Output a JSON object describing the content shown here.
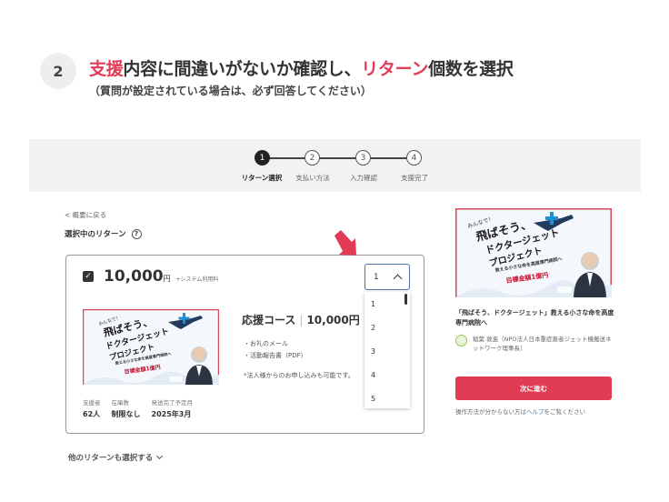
{
  "instruction": {
    "step_number": "2",
    "accent_1": "支援",
    "part_1": "内容に間違いがないか確認し、",
    "accent_2": "リターン",
    "part_2": "個数を選択",
    "subtitle": "（質問が設定されている場合は、必ず回答してください）"
  },
  "stepper": {
    "steps": [
      {
        "num": "1",
        "label": "リターン選択",
        "active": true
      },
      {
        "num": "2",
        "label": "支払い方法",
        "active": false
      },
      {
        "num": "3",
        "label": "入力確認",
        "active": false
      },
      {
        "num": "4",
        "label": "支援完了",
        "active": false
      }
    ]
  },
  "page": {
    "back_link": "< 概要に戻る",
    "selected_heading": "選択中のリターン",
    "help_icon": "?"
  },
  "reward": {
    "price": "10,000",
    "yen": "円",
    "fee_note": "+システム利用料",
    "course_name": "応援コース",
    "course_price": "10,000円",
    "items": [
      "・お礼のメール",
      "・活動報告書（PDF）"
    ],
    "note": "*法人様からのお申し込みも可能です。",
    "stats": [
      {
        "label": "支援者",
        "value": "62人"
      },
      {
        "label": "在庫数",
        "value": "制限なし"
      },
      {
        "label": "発送完了予定月",
        "value": "2025年3月"
      }
    ]
  },
  "quantity": {
    "selected": "1",
    "options": [
      "1",
      "2",
      "3",
      "4",
      "5"
    ]
  },
  "other_returns_link": "他のリターンも選択する",
  "sidebar": {
    "project_title": "「飛ばそう、ドクタージェット」救える小さな命を高度専門病院へ",
    "org_name": "稲葉 敦進（NPO法人日本重症患者ジェット機搬送ネットワーク理事長）",
    "cta_label": "次に進む",
    "help_prefix": "操作方法が分からない方は",
    "help_link": "ヘルプ",
    "help_suffix": "をご覧ください"
  },
  "banner": {
    "small": "みんなで！",
    "line1": "飛ばそう、",
    "line2": "ドクタージェット",
    "line3": "プロジェクト",
    "sub": "救える小さな命を高度専門病院へ",
    "goal": "目標金額1億円"
  },
  "colors": {
    "accent": "#e23b55",
    "link": "#3b7fc4",
    "select_border": "#4a6fa5",
    "stepbar_bg": "#f2f2f2"
  }
}
